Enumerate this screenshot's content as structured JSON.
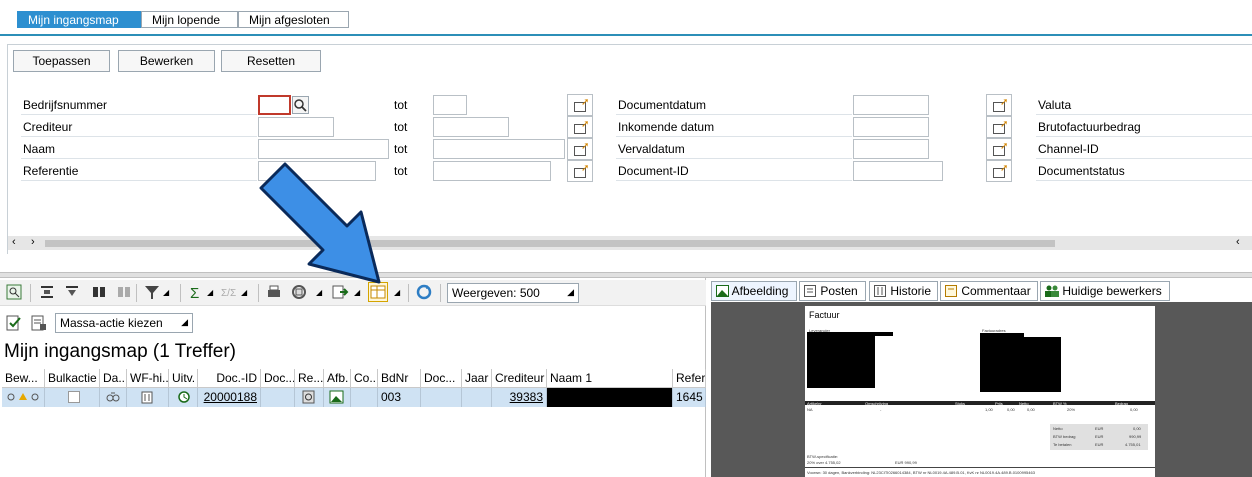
{
  "tabs": [
    {
      "label": "Mijn ingangsmap",
      "active": true
    },
    {
      "label": "Mijn lopende",
      "active": false
    },
    {
      "label": "Mijn afgesloten",
      "active": false
    }
  ],
  "filter_buttons": {
    "apply": "Toepassen",
    "edit": "Bewerken",
    "reset": "Resetten"
  },
  "filters_left": [
    {
      "label": "Bedrijfsnummer",
      "to": "tot"
    },
    {
      "label": "Crediteur",
      "to": "tot"
    },
    {
      "label": "Naam",
      "to": "tot"
    },
    {
      "label": "Referentie",
      "to": "tot"
    }
  ],
  "filters_mid": [
    "Documentdatum",
    "Inkomende datum",
    "Vervaldatum",
    "Document-ID"
  ],
  "filters_right": [
    "Valuta",
    "Brutofactuurbedrag",
    "Channel-ID",
    "Documentstatus"
  ],
  "toolbar": {
    "display_label": "Weergeven: 500",
    "mass_action_label": "Massa-actie kiezen"
  },
  "list_title": "Mijn ingangsmap (1  Treffer)",
  "table": {
    "headers": [
      "Bew...",
      "Bulkactie",
      "Da...",
      "WF-hi...",
      "Uitv.",
      "Doc.-ID",
      "Doc...",
      "Re...",
      "Afb.",
      "Co...",
      "BdNr",
      "Doc...",
      "Jaar",
      "Crediteur",
      "Naam 1",
      "Refer"
    ],
    "row": {
      "doc_id": "20000188",
      "bdnr": "003",
      "crediteur": "39383",
      "refer": "1645"
    }
  },
  "right_tabs": [
    "Afbeelding",
    "Posten",
    "Historie",
    "Commentaar",
    "Huidige bewerkers"
  ],
  "invoice": {
    "title": "Factuur",
    "left_head": "Leverancier",
    "right_head": "Factuuradres",
    "table_headers": [
      "Artikelnr",
      "Omschrijving",
      "Stuks",
      "Prijs",
      "Netto",
      "BTW %",
      "Bedrag"
    ],
    "row_start": "NA",
    "row_dash": "-",
    "row_values": [
      "1,00",
      "0,00",
      "0,00",
      "20%",
      "0,00"
    ],
    "totals": [
      {
        "label": "Netto",
        "cur": "EUR",
        "value": "0,00"
      },
      {
        "label": "BTW bedrag",
        "cur": "EUR",
        "value": "990,99"
      },
      {
        "label": "Te betalen",
        "cur": "EUR",
        "value": "4.755,01"
      }
    ],
    "vat_spec": "BTW-specificatie:",
    "vat_line": "20% over 4.755,02",
    "vat_amount": "EUR 990,99",
    "footer": "Voorwn: 30 dagen, Bankverbinding: NL23CITI0266014384, BTW nr NL0019.4A.489.B.01, KvK nr NL0019.4A.489.B.0100995463"
  },
  "colors": {
    "accent": "#2d8fd0",
    "row_selected": "#cfe2f3",
    "arrow": "#3d8fe6"
  }
}
